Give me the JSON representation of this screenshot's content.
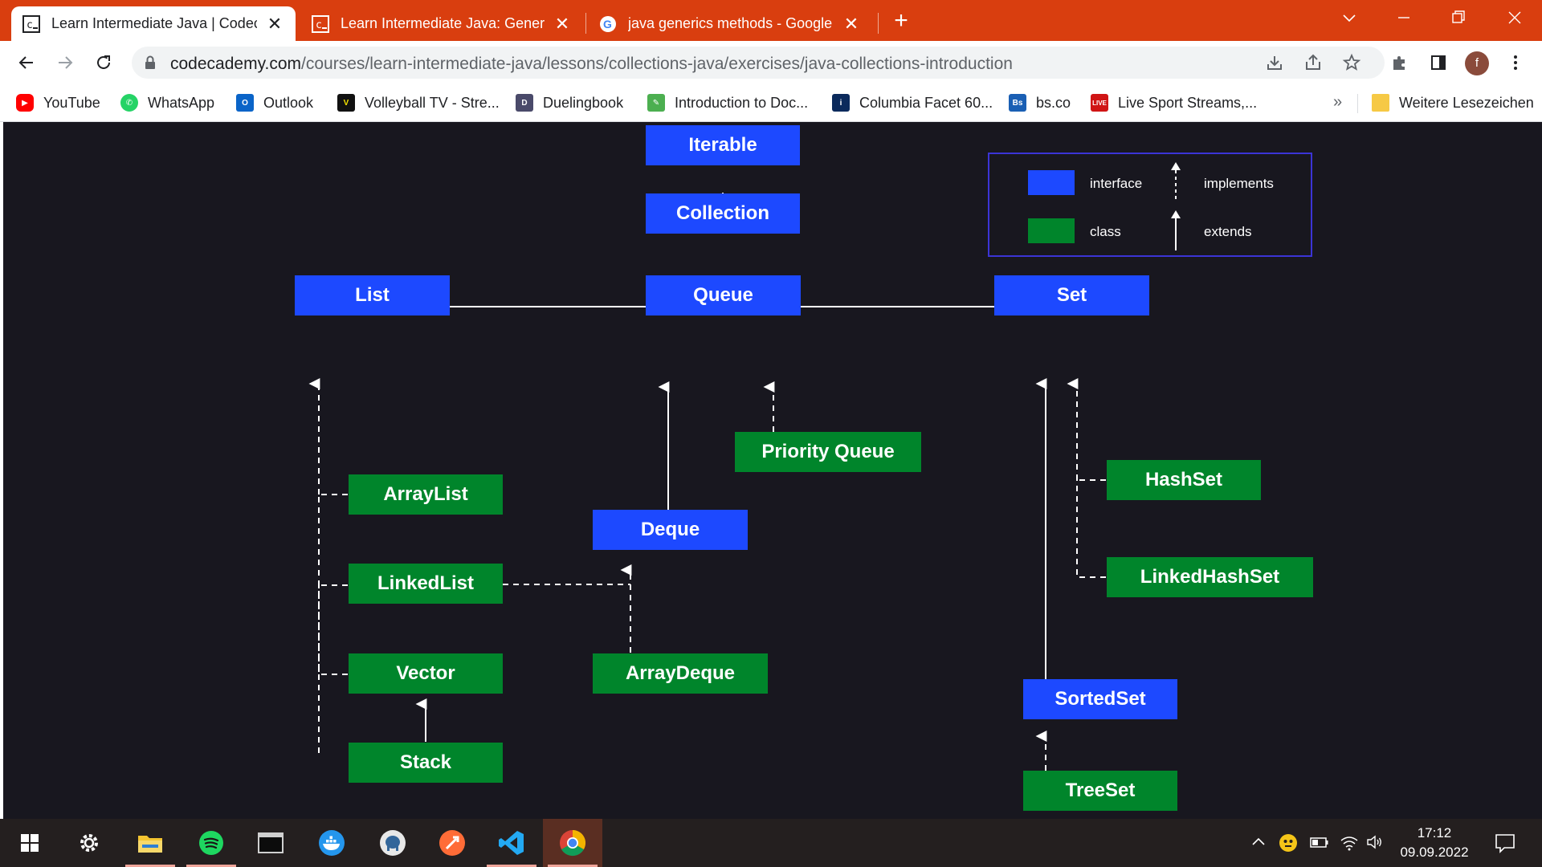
{
  "browser": {
    "tabs": [
      {
        "title": "Learn Intermediate Java | Codeca",
        "active": true
      },
      {
        "title": "Learn Intermediate Java: Generics",
        "active": false
      },
      {
        "title": "java generics methods - Google S",
        "active": false
      }
    ],
    "close_glyph": "✕",
    "new_tab_glyph": "+",
    "url_host": "codecademy.com",
    "url_path": "/courses/learn-intermediate-java/lessons/collections-java/exercises/java-collections-introduction",
    "profile_initial": "f"
  },
  "bookmarks": {
    "items": [
      {
        "label": "YouTube",
        "icon": "youtube-icon",
        "color": "#ff0000"
      },
      {
        "label": "WhatsApp",
        "icon": "whatsapp-icon",
        "color": "#25d366"
      },
      {
        "label": "Outlook",
        "icon": "outlook-icon",
        "color": "#0a64c8"
      },
      {
        "label": "Volleyball TV - Stre...",
        "icon": "volleyball-tv-icon",
        "color": "#111111"
      },
      {
        "label": "Duelingbook",
        "icon": "duelingbook-icon",
        "color": "#4a4a6a"
      },
      {
        "label": "Introduction to Doc...",
        "icon": "docs-icon",
        "color": "#4caf50"
      },
      {
        "label": "Columbia Facet 60...",
        "icon": "columbia-icon",
        "color": "#0b2a5c"
      },
      {
        "label": "bs.co",
        "icon": "bs-icon",
        "color": "#1a5fb4"
      },
      {
        "label": "Live Sport Streams,...",
        "icon": "live-icon",
        "color": "#d01515"
      }
    ],
    "more_glyph": "»",
    "other_folder": "Weitere Lesezeichen"
  },
  "diagram": {
    "nodes": {
      "iterable": "Iterable",
      "collection": "Collection",
      "list": "List",
      "queue": "Queue",
      "set": "Set",
      "arraylist": "ArrayList",
      "linkedlist": "LinkedList",
      "vector": "Vector",
      "stack": "Stack",
      "priorityqueue": "Priority Queue",
      "deque": "Deque",
      "arraydeque": "ArrayDeque",
      "hashset": "HashSet",
      "linkedhashset": "LinkedHashSet",
      "sortedset": "SortedSet",
      "treeset": "TreeSet"
    },
    "legend": {
      "interface": "interface",
      "class": "class",
      "implements": "implements",
      "extends": "extends"
    },
    "colors": {
      "interface": "#1d49ff",
      "class": "#00852b",
      "background": "#18171f",
      "legend_border": "#3b34d6"
    }
  },
  "taskbar": {
    "apps": [
      "windows-start",
      "settings",
      "file-explorer",
      "spotify",
      "terminal",
      "docker",
      "elephant-app",
      "postman",
      "vscode",
      "chrome"
    ],
    "active_app": "chrome",
    "time": "17:12",
    "date": "09.09.2022"
  }
}
